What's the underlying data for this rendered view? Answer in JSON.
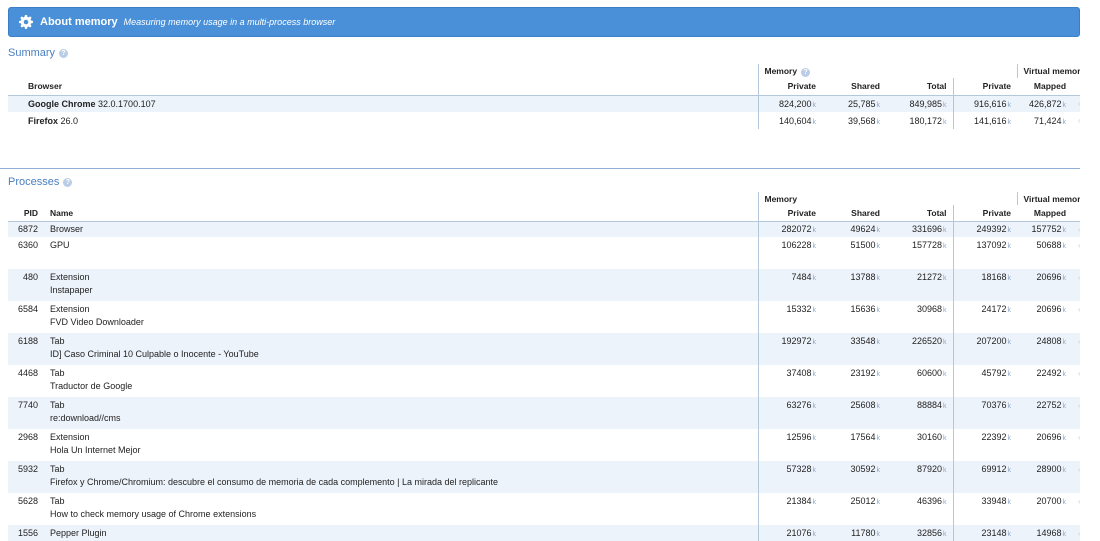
{
  "header": {
    "title": "About memory",
    "subtitle": "Measuring memory usage in a multi-process browser"
  },
  "unit_suffix": "k",
  "summary": {
    "title": "Summary",
    "group_memory": "Memory",
    "group_virtual": "Virtual memory",
    "col_browser": "Browser",
    "col_private": "Private",
    "col_shared": "Shared",
    "col_total": "Total",
    "col_vprivate": "Private",
    "col_mapped": "Mapped",
    "rows": [
      {
        "name": "Google Chrome",
        "version": "32.0.1700.107",
        "private": "824,200",
        "shared": "25,785",
        "total": "849,985",
        "vprivate": "916,616",
        "mapped": "426,872"
      },
      {
        "name": "Firefox",
        "version": "26.0",
        "private": "140,604",
        "shared": "39,568",
        "total": "180,172",
        "vprivate": "141,616",
        "mapped": "71,424"
      }
    ]
  },
  "processes": {
    "title": "Processes",
    "group_memory": "Memory",
    "group_virtual": "Virtual memory",
    "col_pid": "PID",
    "col_name": "Name",
    "col_private": "Private",
    "col_shared": "Shared",
    "col_total": "Total",
    "col_vprivate": "Private",
    "col_mapped": "Mapped",
    "rows": [
      {
        "pid": "6872",
        "type": "Browser",
        "detail": "",
        "private": "282072",
        "shared": "49624",
        "total": "331696",
        "vprivate": "249392",
        "mapped": "157752"
      },
      {
        "pid": "6360",
        "type": "GPU",
        "detail": "",
        "private": "106228",
        "shared": "51500",
        "total": "157728",
        "vprivate": "137092",
        "mapped": "50688"
      },
      {
        "pid": "480",
        "type": "Extension",
        "detail": "Instapaper",
        "private": "7484",
        "shared": "13788",
        "total": "21272",
        "vprivate": "18168",
        "mapped": "20696"
      },
      {
        "pid": "6584",
        "type": "Extension",
        "detail": "FVD Video Downloader",
        "private": "15332",
        "shared": "15636",
        "total": "30968",
        "vprivate": "24172",
        "mapped": "20696"
      },
      {
        "pid": "6188",
        "type": "Tab",
        "detail": "ID] Caso Criminal 10 Culpable o Inocente - YouTube",
        "private": "192972",
        "shared": "33548",
        "total": "226520",
        "vprivate": "207200",
        "mapped": "24808"
      },
      {
        "pid": "4468",
        "type": "Tab",
        "detail": "Traductor de Google",
        "private": "37408",
        "shared": "23192",
        "total": "60600",
        "vprivate": "45792",
        "mapped": "22492"
      },
      {
        "pid": "7740",
        "type": "Tab",
        "detail": "re:download//cms",
        "private": "63276",
        "shared": "25608",
        "total": "88884",
        "vprivate": "70376",
        "mapped": "22752"
      },
      {
        "pid": "2968",
        "type": "Extension",
        "detail": "Hola Un Internet Mejor",
        "private": "12596",
        "shared": "17564",
        "total": "30160",
        "vprivate": "22392",
        "mapped": "20696"
      },
      {
        "pid": "5932",
        "type": "Tab",
        "detail": "Firefox y Chrome/Chromium: descubre el consumo de memoria de cada complemento | La mirada del replicante",
        "private": "57328",
        "shared": "30592",
        "total": "87920",
        "vprivate": "69912",
        "mapped": "28900"
      },
      {
        "pid": "5628",
        "type": "Tab",
        "detail": "How to check memory usage of Chrome extensions",
        "private": "21384",
        "shared": "25012",
        "total": "46396",
        "vprivate": "33948",
        "mapped": "20700"
      },
      {
        "pid": "1556",
        "type": "Pepper Plugin",
        "detail": "",
        "private": "21076",
        "shared": "11780",
        "total": "32856",
        "vprivate": "23148",
        "mapped": "14968"
      }
    ]
  }
}
